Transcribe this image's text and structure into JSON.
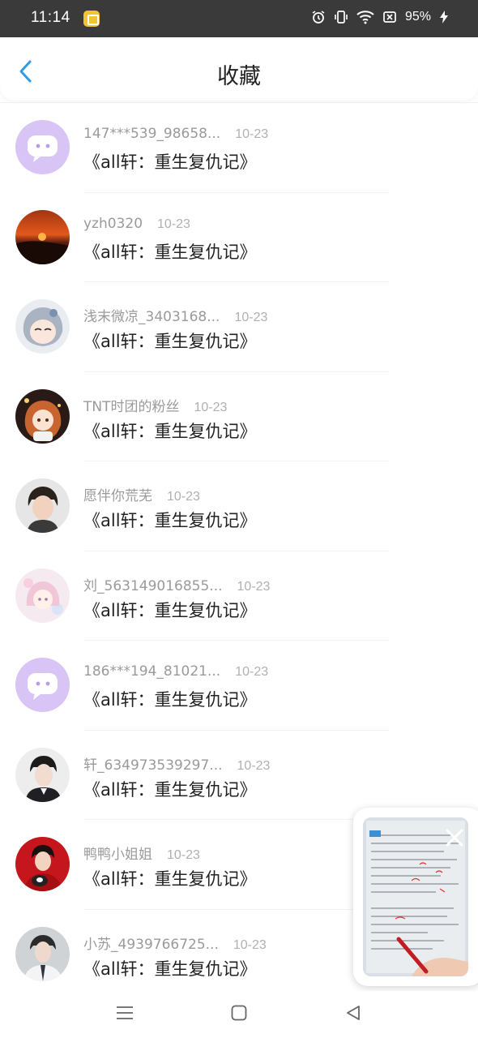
{
  "status_bar": {
    "time": "11:14",
    "battery": "95%"
  },
  "header": {
    "title": "收藏"
  },
  "items": [
    {
      "username": "147***539_98658...",
      "date": "10-23",
      "title": "《all轩：重生复仇记》",
      "avatar": "default-chat"
    },
    {
      "username": "yzh0320",
      "date": "10-23",
      "title": "《all轩：重生复仇记》",
      "avatar": "sunset"
    },
    {
      "username": "浅末微凉_3403168...",
      "date": "10-23",
      "title": "《all轩：重生复仇记》",
      "avatar": "anime-silver"
    },
    {
      "username": "TNT时团的粉丝",
      "date": "10-23",
      "title": "《all轩：重生复仇记》",
      "avatar": "anime-orange"
    },
    {
      "username": "愿伴你荒芜",
      "date": "10-23",
      "title": "《all轩：重生复仇记》",
      "avatar": "portrait-boy"
    },
    {
      "username": "刘_563149016855...",
      "date": "10-23",
      "title": "《all轩：重生复仇记》",
      "avatar": "anime-pink"
    },
    {
      "username": "186***194_81021...",
      "date": "10-23",
      "title": "《all轩：重生复仇记》",
      "avatar": "default-chat"
    },
    {
      "username": "轩_634973539297...",
      "date": "10-23",
      "title": "《all轩：重生复仇记》",
      "avatar": "portrait-suit"
    },
    {
      "username": "鸭鸭小姐姐",
      "date": "10-23",
      "title": "《all轩：重生复仇记》",
      "avatar": "portrait-red"
    },
    {
      "username": "小苏_4939766725...",
      "date": "10-23",
      "title": "《all轩：重生复仇记》",
      "avatar": "portrait-tie"
    }
  ],
  "colors": {
    "accent": "#2f9be8",
    "title_text": "#222222",
    "meta_text": "#9a9a9a",
    "default_avatar": "#d8c4f5"
  },
  "icons": {
    "back": "chevron-left-icon",
    "close": "close-icon",
    "nav": [
      "menu-icon",
      "home-icon",
      "back-triangle-icon"
    ]
  }
}
